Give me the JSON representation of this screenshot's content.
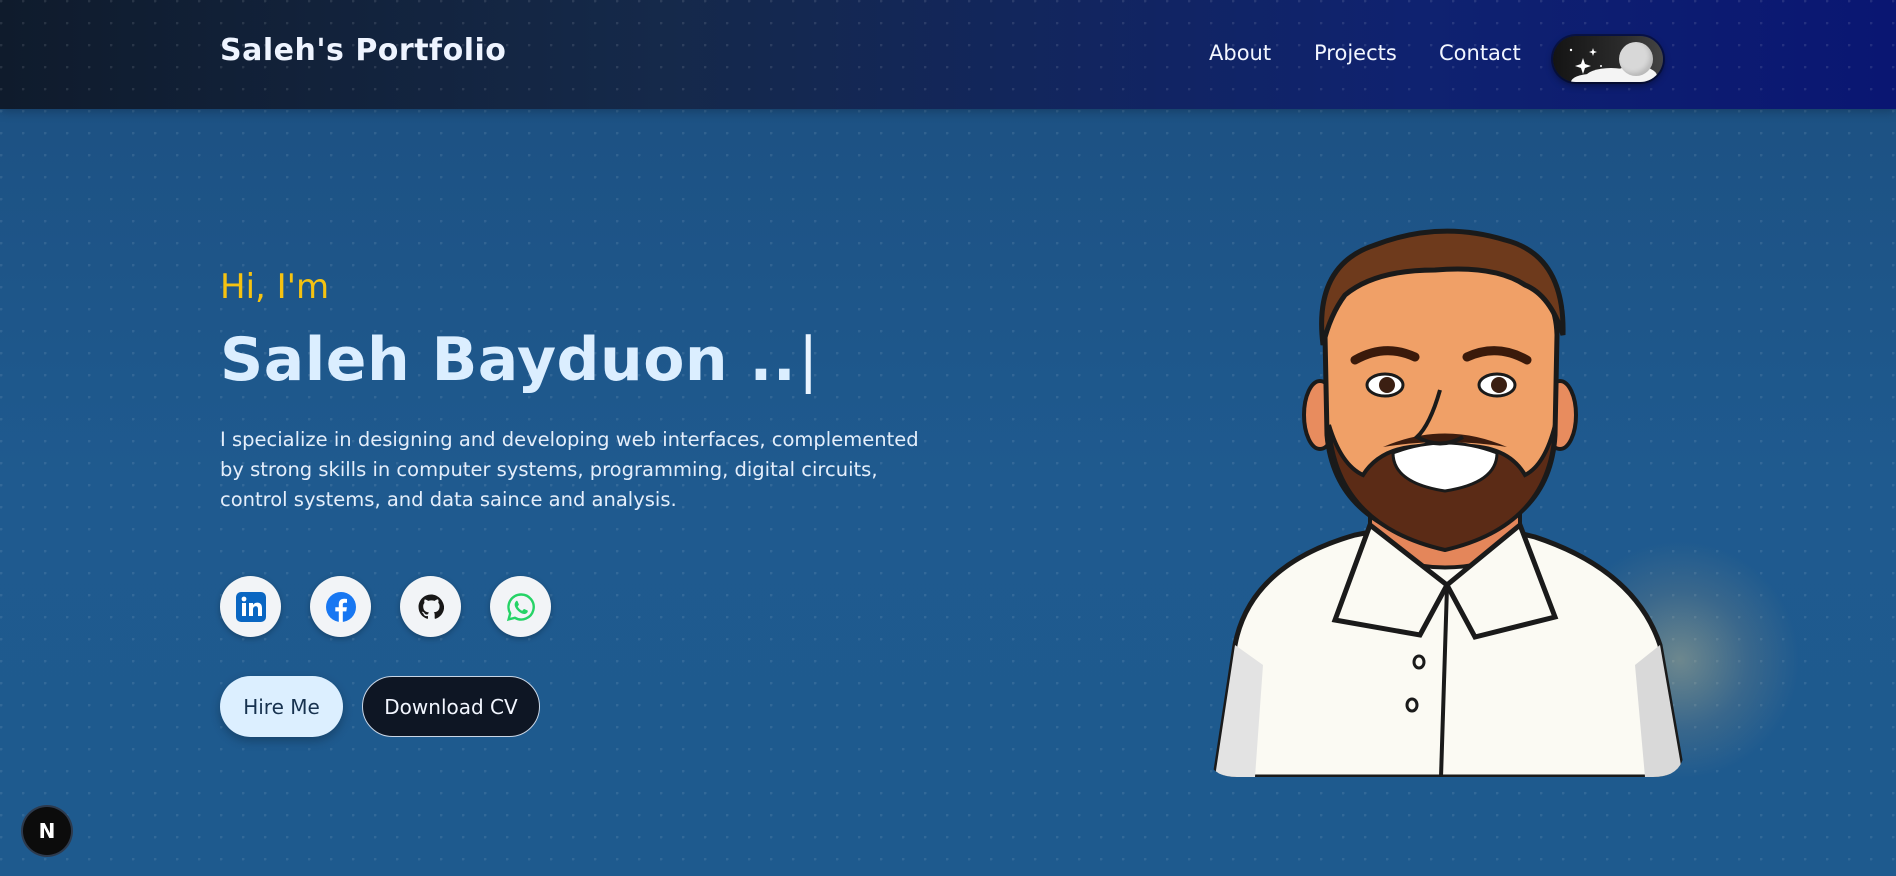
{
  "header": {
    "logo": "Saleh's Portfolio",
    "nav": {
      "about": "About",
      "projects": "Projects",
      "contact": "Contact"
    },
    "theme_toggle": {
      "icon": "moon-icon",
      "state": "dark"
    }
  },
  "hero": {
    "greeting": "Hi, I'm",
    "name": "Saleh Bayduon ..",
    "cursor": "|",
    "description": "I specialize in designing and developing web interfaces, complemented by strong skills in computer systems, programming, digital circuits, control systems, and data saince and analysis.",
    "social": [
      {
        "name": "linkedin-icon",
        "color": "#0a66c2"
      },
      {
        "name": "facebook-icon",
        "color": "#1877f2"
      },
      {
        "name": "github-icon",
        "color": "#181717"
      },
      {
        "name": "whatsapp-icon",
        "color": "#25d366"
      }
    ],
    "buttons": {
      "hire": "Hire Me",
      "cv": "Download CV"
    }
  },
  "fab": {
    "label": "N"
  },
  "colors": {
    "accent": "#f5c211",
    "background": "#1d5589",
    "header": "#0b1770"
  }
}
